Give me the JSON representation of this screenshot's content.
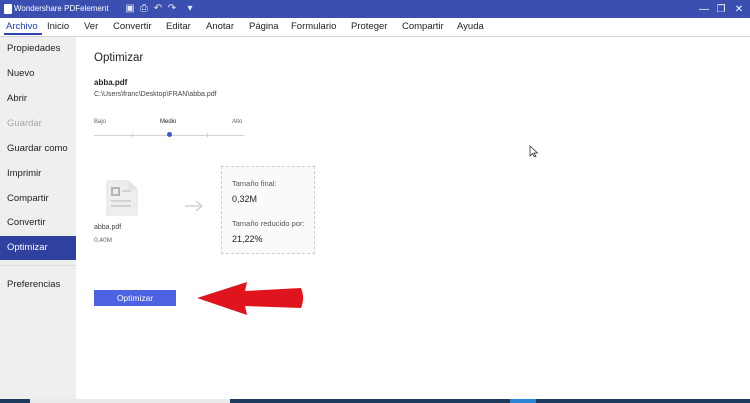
{
  "titlebar": {
    "title": "Wondershare PDFelement"
  },
  "menu": [
    "Archivo",
    "Inicio",
    "Ver",
    "Convertir",
    "Editar",
    "Anotar",
    "Página",
    "Formulario",
    "Proteger",
    "Compartir",
    "Ayuda"
  ],
  "sidebar": {
    "items": [
      {
        "label": "Propiedades"
      },
      {
        "label": "Nuevo"
      },
      {
        "label": "Abrir"
      },
      {
        "label": "Guardar"
      },
      {
        "label": "Guardar como"
      },
      {
        "label": "Imprimir"
      },
      {
        "label": "Compartir"
      },
      {
        "label": "Convertir"
      },
      {
        "label": "Optimizar"
      },
      {
        "label": "Preferencias"
      }
    ],
    "active": "Optimizar",
    "disabled": "Guardar"
  },
  "main": {
    "title": "Optimizar",
    "file_name": "abba.pdf",
    "file_path": "C:\\Users\\franc\\Desktop\\FRAN\\abba.pdf",
    "quality": {
      "low": "Bajo",
      "mid": "Medio",
      "high": "Alto",
      "selected": "Medio"
    },
    "original": {
      "name": "abba.pdf",
      "size": "0,40M"
    },
    "result": {
      "final_label": "Tamaño final:",
      "final_value": "0,32M",
      "reduced_label": "Tamaño reducido por:",
      "reduced_value": "21,22%"
    },
    "button_label": "Optimizar"
  },
  "colors": {
    "titlebar": "#3a4fb0",
    "active_sidebar": "#30409f",
    "button": "#4d63e3",
    "annotation_arrow": "#e0141c"
  }
}
